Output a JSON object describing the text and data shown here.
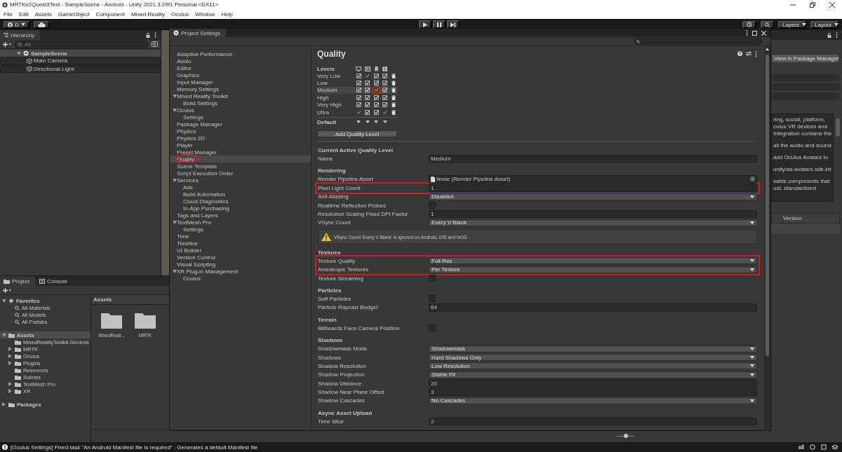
{
  "title_bar": {
    "title": "MRTKv2Quest3Test - SampleScene - Android - Unity 2021.3.29f1 Personal <DX11>"
  },
  "menu": [
    "File",
    "Edit",
    "Assets",
    "GameObject",
    "Component",
    "Mixed Reality",
    "Oculus",
    "Window",
    "Help"
  ],
  "toolbar": {
    "account": "D",
    "layers": "Layers",
    "layout": "Layout"
  },
  "hierarchy": {
    "tab": "Hierarchy",
    "search_placeholder": "All",
    "tree": [
      {
        "label": "SampleScene",
        "kind": "scene",
        "expanded": true,
        "children": [
          {
            "label": "Main Camera",
            "kind": "object"
          },
          {
            "label": "Directional Light",
            "kind": "object"
          }
        ]
      }
    ]
  },
  "project": {
    "tabs": [
      {
        "label": "Project",
        "selected": true
      },
      {
        "label": "Console",
        "selected": false
      }
    ],
    "tree": [
      {
        "label": "Favorites",
        "kind": "favorites",
        "expanded": true,
        "selected": false,
        "children": [
          {
            "label": "All Materials",
            "kind": "search",
            "selected": false
          },
          {
            "label": "All Models",
            "kind": "search",
            "selected": false
          },
          {
            "label": "All Prefabs",
            "kind": "search",
            "selected": false
          }
        ]
      },
      {
        "label": "Assets",
        "kind": "folder",
        "expanded": true,
        "selected": true,
        "children": [
          {
            "label": "MixedRealityToolkit.Generat",
            "kind": "folder",
            "selected": false
          },
          {
            "label": "MRTK",
            "kind": "folder",
            "expanded": false,
            "selected": false
          },
          {
            "label": "Oculus",
            "kind": "folder",
            "expanded": false,
            "selected": false
          },
          {
            "label": "Plugins",
            "kind": "folder",
            "expanded": false,
            "selected": false
          },
          {
            "label": "Resources",
            "kind": "folder",
            "selected": false
          },
          {
            "label": "Scenes",
            "kind": "folder",
            "selected": false
          },
          {
            "label": "TextMesh Pro",
            "kind": "folder",
            "expanded": false,
            "selected": false
          },
          {
            "label": "XR",
            "kind": "folder",
            "expanded": false,
            "selected": false
          }
        ]
      },
      {
        "label": "Packages",
        "kind": "folder",
        "expanded": false,
        "selected": false
      }
    ],
    "assets_header": "Assets",
    "assets": [
      {
        "label": "MixedReali..."
      },
      {
        "label": "MRTK"
      }
    ],
    "zoom_slider": {
      "level": 0.55
    }
  },
  "project_settings": {
    "title": "Project Settings",
    "sidebar": [
      {
        "label": "Adaptive Performance",
        "selected": false
      },
      {
        "label": "Audio",
        "selected": false
      },
      {
        "label": "Editor",
        "selected": false
      },
      {
        "label": "Graphics",
        "selected": false
      },
      {
        "label": "Input Manager",
        "selected": false
      },
      {
        "label": "Memory Settings",
        "selected": false
      },
      {
        "label": "Mixed Reality Toolkit",
        "selected": false,
        "expanded": true,
        "children": [
          {
            "label": "Build Settings",
            "selected": false
          }
        ]
      },
      {
        "label": "Oculus",
        "selected": false,
        "expanded": true,
        "children": [
          {
            "label": "Settings",
            "selected": false
          }
        ]
      },
      {
        "label": "Package Manager",
        "selected": false
      },
      {
        "label": "Physics",
        "selected": false
      },
      {
        "label": "Physics 2D",
        "selected": false
      },
      {
        "label": "Player",
        "selected": false
      },
      {
        "label": "Preset Manager",
        "selected": false
      },
      {
        "label": "Quality",
        "selected": true,
        "highlighted": true
      },
      {
        "label": "Scene Template",
        "selected": false
      },
      {
        "label": "Script Execution Order",
        "selected": false
      },
      {
        "label": "Services",
        "selected": false,
        "expanded": true,
        "children": [
          {
            "label": "Ads",
            "selected": false
          },
          {
            "label": "Build Automation",
            "selected": false
          },
          {
            "label": "Cloud Diagnostics",
            "selected": false
          },
          {
            "label": "In-App Purchasing",
            "selected": false
          }
        ]
      },
      {
        "label": "Tags and Layers",
        "selected": false
      },
      {
        "label": "TextMesh Pro",
        "selected": false,
        "expanded": true,
        "children": [
          {
            "label": "Settings",
            "selected": false
          }
        ]
      },
      {
        "label": "Time",
        "selected": false
      },
      {
        "label": "Timeline",
        "selected": false
      },
      {
        "label": "UI Builder",
        "selected": false
      },
      {
        "label": "Version Control",
        "selected": false
      },
      {
        "label": "Visual Scripting",
        "selected": false
      },
      {
        "label": "XR Plug-in Management",
        "selected": false,
        "expanded": true,
        "children": [
          {
            "label": "Oculus",
            "selected": false
          }
        ]
      }
    ],
    "page_title": "Quality",
    "levels_label": "Levels",
    "levels": [
      {
        "name": "Very Low",
        "selected": false,
        "platforms": [
          {
            "checked": true,
            "default": false
          },
          {
            "checked": true,
            "default": true
          },
          {
            "checked": true,
            "default": false
          },
          {
            "checked": true,
            "default": false
          }
        ]
      },
      {
        "name": "Low",
        "selected": false,
        "platforms": [
          {
            "checked": true,
            "default": false
          },
          {
            "checked": true,
            "default": false
          },
          {
            "checked": true,
            "default": false
          },
          {
            "checked": true,
            "default": false
          }
        ]
      },
      {
        "name": "Medium",
        "selected": true,
        "platforms": [
          {
            "checked": true,
            "default": false
          },
          {
            "checked": true,
            "default": false
          },
          {
            "checked": true,
            "default": true,
            "highlighted": true
          },
          {
            "checked": true,
            "default": false
          }
        ]
      },
      {
        "name": "High",
        "selected": false,
        "platforms": [
          {
            "checked": true,
            "default": false
          },
          {
            "checked": true,
            "default": false
          },
          {
            "checked": true,
            "default": false
          },
          {
            "checked": true,
            "default": false
          }
        ]
      },
      {
        "name": "Very High",
        "selected": false,
        "platforms": [
          {
            "checked": true,
            "default": false
          },
          {
            "checked": true,
            "default": false
          },
          {
            "checked": true,
            "default": false
          },
          {
            "checked": true,
            "default": false
          }
        ]
      },
      {
        "name": "Ultra",
        "selected": false,
        "platforms": [
          {
            "checked": true,
            "default": true
          },
          {
            "checked": true,
            "default": false
          },
          {
            "checked": true,
            "default": false
          },
          {
            "checked": true,
            "default": true
          }
        ]
      }
    ],
    "default_label": "Default",
    "add_button": "Add Quality Level",
    "rows": [
      {
        "kind": "section",
        "label": "Current Active Quality Level"
      },
      {
        "kind": "field",
        "label": "Name",
        "value": "Medium"
      },
      {
        "kind": "section",
        "label": "Rendering"
      },
      {
        "kind": "object",
        "label": "Render Pipeline Asset",
        "value": "None (Render Pipeline Asset)"
      },
      {
        "kind": "field",
        "label": "Pixel Light Count",
        "value": "1",
        "highlighted": true
      },
      {
        "kind": "dropdown",
        "label": "Anti Aliasing",
        "value": "Disabled"
      },
      {
        "kind": "checkbox",
        "label": "Realtime Reflection Probes",
        "checked": false
      },
      {
        "kind": "field",
        "label": "Resolution Scaling Fixed DPI Factor",
        "value": "1"
      },
      {
        "kind": "dropdown",
        "label": "VSync Count",
        "value": "Every V Blank"
      },
      {
        "kind": "warning",
        "label": "VSync Count 'Every V Blank' is ignored on Android, iOS and tvOS."
      },
      {
        "kind": "section",
        "label": "Textures"
      },
      {
        "kind": "dropdown",
        "label": "Texture Quality",
        "value": "Full Res",
        "highlighted": true
      },
      {
        "kind": "dropdown",
        "label": "Anisotropic Textures",
        "value": "Per Texture",
        "highlighted": true
      },
      {
        "kind": "checkbox",
        "label": "Texture Streaming",
        "checked": false
      },
      {
        "kind": "section",
        "label": "Particles"
      },
      {
        "kind": "checkbox",
        "label": "Soft Particles",
        "checked": false
      },
      {
        "kind": "field",
        "label": "Particle Raycast Budget",
        "value": "64"
      },
      {
        "kind": "section",
        "label": "Terrain"
      },
      {
        "kind": "checkbox",
        "label": "Billboards Face Camera Position",
        "checked": false
      },
      {
        "kind": "section",
        "label": "Shadows"
      },
      {
        "kind": "dropdown",
        "label": "Shadowmask Mode",
        "value": "Shadowmask"
      },
      {
        "kind": "dropdown",
        "label": "Shadows",
        "value": "Hard Shadows Only"
      },
      {
        "kind": "dropdown",
        "label": "Shadow Resolution",
        "value": "Low Resolution"
      },
      {
        "kind": "dropdown",
        "label": "Shadow Projection",
        "value": "Stable Fit"
      },
      {
        "kind": "field",
        "label": "Shadow Distance",
        "value": "20"
      },
      {
        "kind": "field",
        "label": "Shadow Near Plane Offset",
        "value": "3"
      },
      {
        "kind": "dropdown",
        "label": "Shadow Cascades",
        "value": "No Cascades"
      },
      {
        "kind": "section",
        "label": "Async Asset Upload"
      },
      {
        "kind": "field",
        "label": "Time Slice",
        "value": "2"
      }
    ]
  },
  "inspector": {
    "button": "View in Package Manager",
    "description": [
      [
        "ring, social, platform,",
        "culus VR devices and",
        "Integration contains the"
      ],
      [
        "all the audio and sound"
      ],
      [
        "add Oculus Avatars to"
      ],
      [
        "unity/as-avatars-sdk-int"
      ],
      [
        "sable components that",
        "ust, standardized"
      ]
    ],
    "column_header": "Version"
  },
  "status_bar": {
    "message": "[Oculus Settings] Fixed task \"An Android Manifest file is required\" : Generates a default Manifest file"
  }
}
